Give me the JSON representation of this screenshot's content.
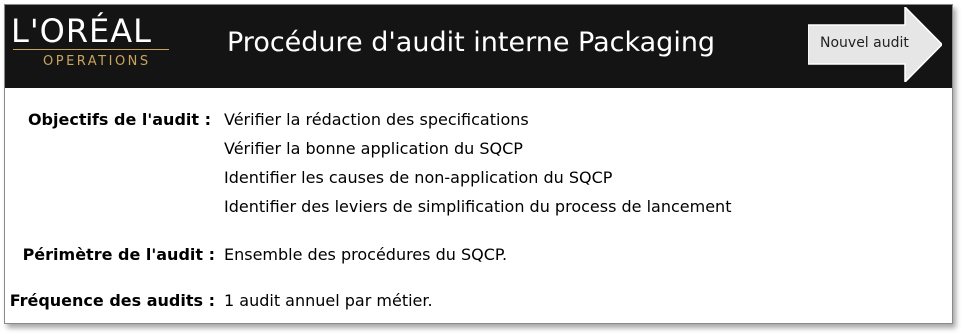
{
  "header": {
    "logo": {
      "brand": "L'ORÉAL",
      "subtitle": "OPERATIONS"
    },
    "title": "Procédure d'audit interne Packaging",
    "new_audit_button": {
      "label": "Nouvel audit",
      "icon": "right-arrow-shape"
    }
  },
  "colors": {
    "header_background": "#141414",
    "logo_gold": "#c9a45c",
    "button_fill": "#e6e6e6"
  },
  "fields": {
    "objectives": {
      "label": "Objectifs de l'audit :",
      "values": [
        "Vérifier la rédaction des specifications",
        "Vérifier la bonne application du SQCP",
        "Identifier les causes de non-application du SQCP",
        "Identifier des leviers de simplification du process de lancement"
      ]
    },
    "scope": {
      "label": "Périmètre de l'audit :",
      "value": "Ensemble des procédures du SQCP."
    },
    "frequency": {
      "label": "Fréquence des audits :",
      "value": "1 audit annuel par métier."
    }
  }
}
